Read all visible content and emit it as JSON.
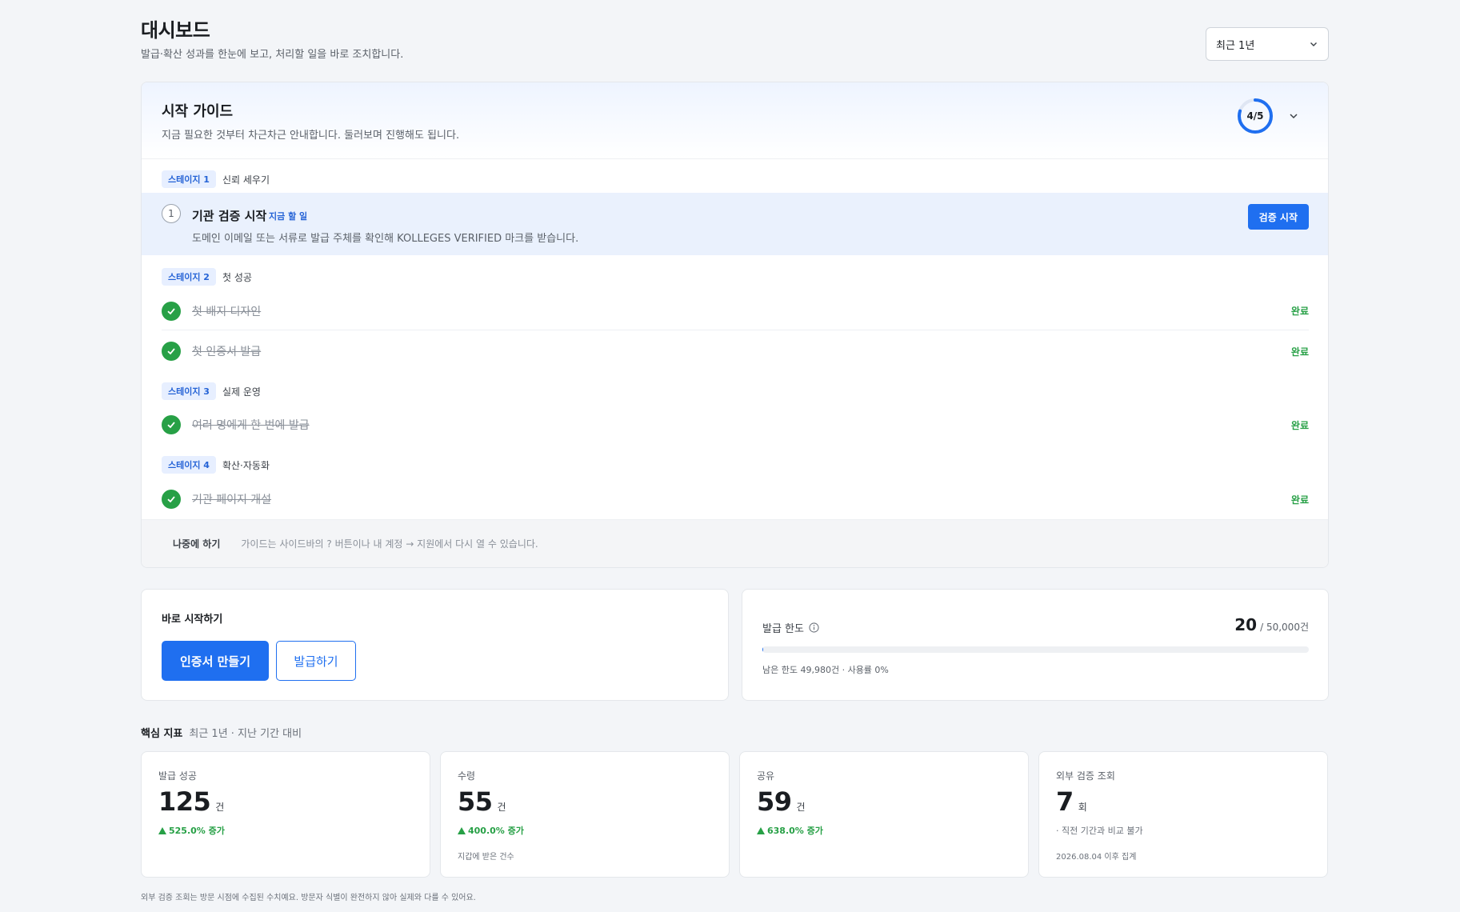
{
  "header": {
    "title": "대시보드",
    "subtitle": "발급·확산 성과를 한눈에 보고, 처리할 일을 바로 조치합니다.",
    "period_select": "최근 1년"
  },
  "guide": {
    "title": "시작 가이드",
    "subtitle": "지금 필요한 것부터 차근차근 안내합니다. 둘러보며 진행해도 됩니다.",
    "progress_text": "4/5",
    "progress_fraction": 0.8,
    "stages": [
      {
        "badge": "스테이지 1",
        "name": "신뢰 세우기"
      },
      {
        "badge": "스테이지 2",
        "name": "첫 성공"
      },
      {
        "badge": "스테이지 3",
        "name": "실제 운영"
      },
      {
        "badge": "스테이지 4",
        "name": "확산·자동화"
      }
    ],
    "active_task": {
      "step": "1",
      "title": "기관 검증 시작",
      "tag": "지금 할 일",
      "desc": "도메인 이메일 또는 서류로 발급 주체를 확인해 KOLLEGES VERIFIED 마크를 받습니다.",
      "button": "검증 시작"
    },
    "done_tasks": [
      {
        "title": "첫 배지 디자인",
        "status": "완료"
      },
      {
        "title": "첫 인증서 발급",
        "status": "완료"
      },
      {
        "title": "여러 명에게 한 번에 발급",
        "status": "완료"
      },
      {
        "title": "기관 페이지 개설",
        "status": "완료"
      }
    ],
    "later_button": "나중에 하기",
    "footer_hint": "가이드는 사이드바의 ? 버튼이나 내 계정 → 지원에서 다시 열 수 있습니다."
  },
  "quick_start": {
    "title": "바로 시작하기",
    "primary_button": "인증서 만들기",
    "secondary_button": "발급하기"
  },
  "limit": {
    "title": "발급 한도",
    "used": "20",
    "total": "/ 50,000건",
    "used_fraction": 0.0004,
    "note": "남은 한도 49,980건 · 사용률 0%"
  },
  "metrics": {
    "title": "핵심 지표",
    "subtitle": "최근 1년 · 지난 기간 대비",
    "cards": [
      {
        "label": "발급 성공",
        "value": "125",
        "unit": "건",
        "delta": "525.0% 증가",
        "note": ""
      },
      {
        "label": "수령",
        "value": "55",
        "unit": "건",
        "delta": "400.0% 증가",
        "note": "지갑에 받은 건수"
      },
      {
        "label": "공유",
        "value": "59",
        "unit": "건",
        "delta": "638.0% 증가",
        "note": ""
      },
      {
        "label": "외부 검증 조회",
        "value": "7",
        "unit": "회",
        "delta": "· 직전 기간과 비교 불가",
        "note": "2026.08.04 이후 집계"
      }
    ],
    "footnote": "외부 검증 조회는 방문 시점에 수집된 수치예요. 방문자 식별이 완전하지 않아 실제와 다를 수 있어요."
  },
  "colors": {
    "accent": "#1f6ff0",
    "success": "#27a046",
    "background": "#f3f5f8"
  }
}
